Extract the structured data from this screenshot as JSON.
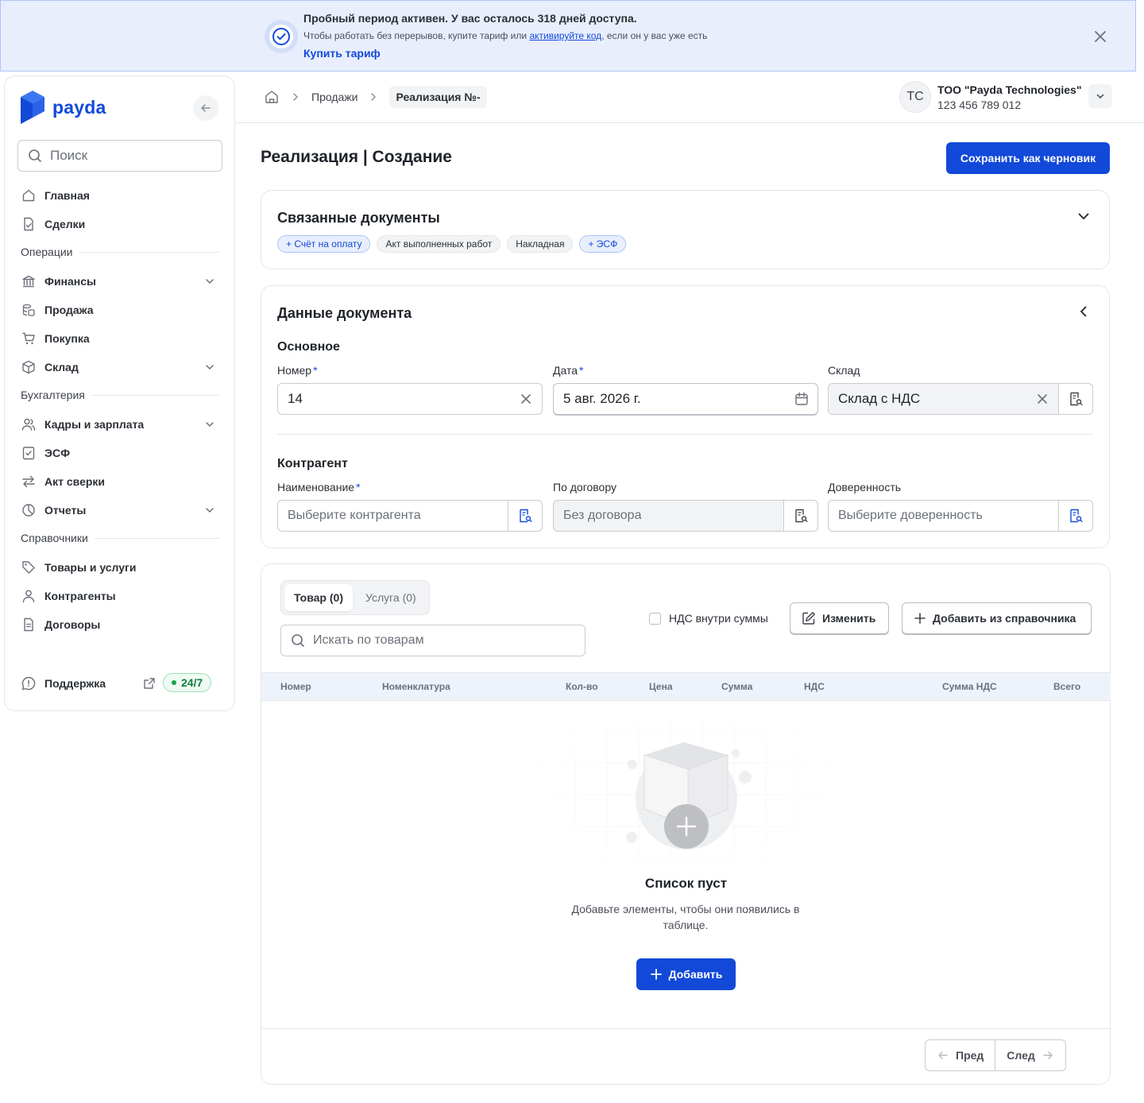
{
  "banner": {
    "title": "Пробный период активен. У вас осталось 318 дней доступа.",
    "subtitle_before": "Чтобы работать без перерывов, купите тариф или ",
    "subtitle_link": "активируйте код",
    "subtitle_after": ", если он у вас уже есть",
    "buy_label": "Купить тариф",
    "accent": "#1249d9"
  },
  "sidebar": {
    "logo": "payda",
    "search_placeholder": "Поиск",
    "items": [
      {
        "label": "Главная",
        "icon": "home-icon"
      },
      {
        "label": "Сделки",
        "icon": "document-check-icon"
      }
    ],
    "section_operations": "Операции",
    "operations": [
      {
        "label": "Финансы",
        "icon": "bank-icon",
        "expandable": true
      },
      {
        "label": "Продажа",
        "icon": "coins-icon"
      },
      {
        "label": "Покупка",
        "icon": "cart-icon"
      },
      {
        "label": "Склад",
        "icon": "box-icon",
        "expandable": true
      }
    ],
    "section_accounting": "Бухгалтерия",
    "accounting": [
      {
        "label": "Кадры и зарплата",
        "icon": "users-icon",
        "expandable": true
      },
      {
        "label": "ЭСФ",
        "icon": "invoice-check-icon"
      },
      {
        "label": "Акт сверки",
        "icon": "arrows-exchange-icon"
      },
      {
        "label": "Отчеты",
        "icon": "pie-chart-icon",
        "expandable": true
      }
    ],
    "section_references": "Справочники",
    "references": [
      {
        "label": "Товары и услуги",
        "icon": "tag-icon"
      },
      {
        "label": "Контрагенты",
        "icon": "user-icon"
      },
      {
        "label": "Договоры",
        "icon": "contract-icon"
      }
    ],
    "support_label": "Поддержка",
    "support_badge": "24/7"
  },
  "header": {
    "breadcrumb_parent": "Продажи",
    "breadcrumb_current": "Реализация №-",
    "org_initials": "TC",
    "org_name": "ТОО \"Payda Technologies\"",
    "org_bin": "123 456 789 012"
  },
  "page": {
    "title": "Реализация | Создание",
    "save_draft_label": "Сохранить как черновик"
  },
  "linked_docs": {
    "title": "Связанные документы",
    "chips": [
      {
        "label": "+ Счёт на оплату",
        "type": "add"
      },
      {
        "label": "Акт выполненных работ",
        "type": "plain"
      },
      {
        "label": "Накладная",
        "type": "plain"
      },
      {
        "label": "+ ЭСФ",
        "type": "add"
      }
    ]
  },
  "doc_data": {
    "title": "Данные документа",
    "basic_title": "Основное",
    "number_label": "Номер",
    "number_value": "14",
    "date_label": "Дата",
    "date_value": "5 авг. 2026 г.",
    "warehouse_label": "Склад",
    "warehouse_value": "Склад с НДС",
    "counterparty_title": "Контрагент",
    "name_label": "Наименование",
    "name_placeholder": "Выберите контрагента",
    "contract_label": "По договору",
    "contract_placeholder": "Без договора",
    "poa_label": "Доверенность",
    "poa_placeholder": "Выберите доверенность"
  },
  "items": {
    "tab_goods": "Товар (0)",
    "tab_services": "Услуга (0)",
    "search_placeholder": "Искать по товарам",
    "vat_inside_label": "НДС внутри суммы",
    "vat_inside_checked": false,
    "edit_label": "Изменить",
    "add_from_ref_label": "Добавить из справочника",
    "columns": [
      "Номер",
      "Номенклатура",
      "Кол-во",
      "Цена",
      "Сумма",
      "НДС",
      "Сумма НДС",
      "Всего"
    ],
    "empty_title": "Список пуст",
    "empty_desc": "Добавьте элементы, чтобы они появились в таблице.",
    "add_label": "Добавить",
    "prev_label": "Пред",
    "next_label": "След"
  }
}
